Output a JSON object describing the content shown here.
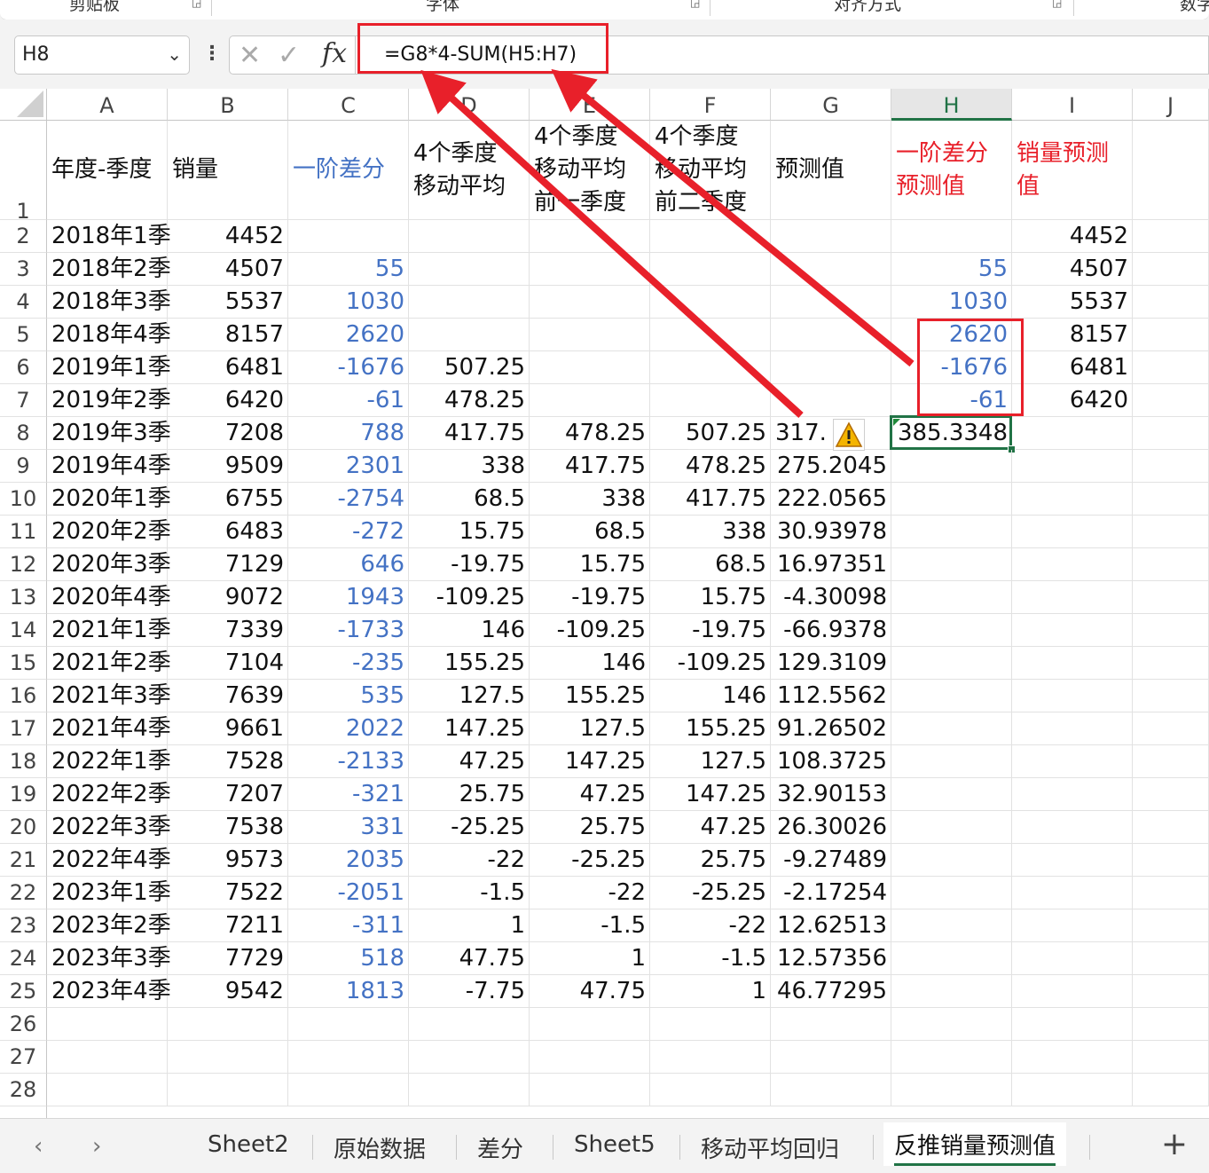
{
  "ribbon": {
    "groups": [
      "剪贴板",
      "字体",
      "对齐方式",
      "数字"
    ]
  },
  "formula_bar": {
    "name_box": "H8",
    "formula": "=G8*4-SUM(H5:H7)"
  },
  "columns": [
    "A",
    "B",
    "C",
    "D",
    "E",
    "F",
    "G",
    "H",
    "I",
    "J"
  ],
  "selected_column": "H",
  "headers": {
    "A": "年度-季度",
    "B": "销量",
    "C": "一阶差分",
    "D_line1": "4个季度",
    "D_line2": "移动平均",
    "E_line1": "4个季度",
    "E_line2": "移动平均",
    "E_line3": "前一季度",
    "F_line1": "4个季度",
    "F_line2": "移动平均",
    "F_line3": "前二季度",
    "G": "预测值",
    "H_line1": "一阶差分",
    "H_line2": "预测值",
    "I_line1": "销量预测",
    "I_line2": "值"
  },
  "rows": [
    {
      "n": "2",
      "A": "2018年1季",
      "B": "4452",
      "C": "",
      "D": "",
      "E": "",
      "F": "",
      "G": "",
      "H": "",
      "I": "4452"
    },
    {
      "n": "3",
      "A": "2018年2季",
      "B": "4507",
      "C": "55",
      "D": "",
      "E": "",
      "F": "",
      "G": "",
      "H": "55",
      "I": "4507"
    },
    {
      "n": "4",
      "A": "2018年3季",
      "B": "5537",
      "C": "1030",
      "D": "",
      "E": "",
      "F": "",
      "G": "",
      "H": "1030",
      "I": "5537"
    },
    {
      "n": "5",
      "A": "2018年4季",
      "B": "8157",
      "C": "2620",
      "D": "",
      "E": "",
      "F": "",
      "G": "",
      "H": "2620",
      "I": "8157"
    },
    {
      "n": "6",
      "A": "2019年1季",
      "B": "6481",
      "C": "-1676",
      "D": "507.25",
      "E": "",
      "F": "",
      "G": "",
      "H": "-1676",
      "I": "6481"
    },
    {
      "n": "7",
      "A": "2019年2季",
      "B": "6420",
      "C": "-61",
      "D": "478.25",
      "E": "",
      "F": "",
      "G": "",
      "H": "-61",
      "I": "6420"
    },
    {
      "n": "8",
      "A": "2019年3季",
      "B": "7208",
      "C": "788",
      "D": "417.75",
      "E": "478.25",
      "F": "507.25",
      "G": "317.",
      "H": "385.3348",
      "I": ""
    },
    {
      "n": "9",
      "A": "2019年4季",
      "B": "9509",
      "C": "2301",
      "D": "338",
      "E": "417.75",
      "F": "478.25",
      "G": "275.2045",
      "H": "",
      "I": ""
    },
    {
      "n": "10",
      "A": "2020年1季",
      "B": "6755",
      "C": "-2754",
      "D": "68.5",
      "E": "338",
      "F": "417.75",
      "G": "222.0565",
      "H": "",
      "I": ""
    },
    {
      "n": "11",
      "A": "2020年2季",
      "B": "6483",
      "C": "-272",
      "D": "15.75",
      "E": "68.5",
      "F": "338",
      "G": "30.93978",
      "H": "",
      "I": ""
    },
    {
      "n": "12",
      "A": "2020年3季",
      "B": "7129",
      "C": "646",
      "D": "-19.75",
      "E": "15.75",
      "F": "68.5",
      "G": "16.97351",
      "H": "",
      "I": ""
    },
    {
      "n": "13",
      "A": "2020年4季",
      "B": "9072",
      "C": "1943",
      "D": "-109.25",
      "E": "-19.75",
      "F": "15.75",
      "G": "-4.30098",
      "H": "",
      "I": ""
    },
    {
      "n": "14",
      "A": "2021年1季",
      "B": "7339",
      "C": "-1733",
      "D": "146",
      "E": "-109.25",
      "F": "-19.75",
      "G": "-66.9378",
      "H": "",
      "I": ""
    },
    {
      "n": "15",
      "A": "2021年2季",
      "B": "7104",
      "C": "-235",
      "D": "155.25",
      "E": "146",
      "F": "-109.25",
      "G": "129.3109",
      "H": "",
      "I": ""
    },
    {
      "n": "16",
      "A": "2021年3季",
      "B": "7639",
      "C": "535",
      "D": "127.5",
      "E": "155.25",
      "F": "146",
      "G": "112.5562",
      "H": "",
      "I": ""
    },
    {
      "n": "17",
      "A": "2021年4季",
      "B": "9661",
      "C": "2022",
      "D": "147.25",
      "E": "127.5",
      "F": "155.25",
      "G": "91.26502",
      "H": "",
      "I": ""
    },
    {
      "n": "18",
      "A": "2022年1季",
      "B": "7528",
      "C": "-2133",
      "D": "47.25",
      "E": "147.25",
      "F": "127.5",
      "G": "108.3725",
      "H": "",
      "I": ""
    },
    {
      "n": "19",
      "A": "2022年2季",
      "B": "7207",
      "C": "-321",
      "D": "25.75",
      "E": "47.25",
      "F": "147.25",
      "G": "32.90153",
      "H": "",
      "I": ""
    },
    {
      "n": "20",
      "A": "2022年3季",
      "B": "7538",
      "C": "331",
      "D": "-25.25",
      "E": "25.75",
      "F": "47.25",
      "G": "26.30026",
      "H": "",
      "I": ""
    },
    {
      "n": "21",
      "A": "2022年4季",
      "B": "9573",
      "C": "2035",
      "D": "-22",
      "E": "-25.25",
      "F": "25.75",
      "G": "-9.27489",
      "H": "",
      "I": ""
    },
    {
      "n": "22",
      "A": "2023年1季",
      "B": "7522",
      "C": "-2051",
      "D": "-1.5",
      "E": "-22",
      "F": "-25.25",
      "G": "-2.17254",
      "H": "",
      "I": ""
    },
    {
      "n": "23",
      "A": "2023年2季",
      "B": "7211",
      "C": "-311",
      "D": "1",
      "E": "-1.5",
      "F": "-22",
      "G": "12.62513",
      "H": "",
      "I": ""
    },
    {
      "n": "24",
      "A": "2023年3季",
      "B": "7729",
      "C": "518",
      "D": "47.75",
      "E": "1",
      "F": "-1.5",
      "G": "12.57356",
      "H": "",
      "I": ""
    },
    {
      "n": "25",
      "A": "2023年4季",
      "B": "9542",
      "C": "1813",
      "D": "-7.75",
      "E": "47.75",
      "F": "1",
      "G": "46.77295",
      "H": "",
      "I": ""
    },
    {
      "n": "26",
      "A": "",
      "B": "",
      "C": "",
      "D": "",
      "E": "",
      "F": "",
      "G": "",
      "H": "",
      "I": ""
    },
    {
      "n": "27",
      "A": "",
      "B": "",
      "C": "",
      "D": "",
      "E": "",
      "F": "",
      "G": "",
      "H": "",
      "I": ""
    },
    {
      "n": "28",
      "A": "",
      "B": "",
      "C": "",
      "D": "",
      "E": "",
      "F": "",
      "G": "",
      "H": "",
      "I": ""
    }
  ],
  "row1_label": "1",
  "sheet_tabs": [
    "Sheet2",
    "原始数据",
    "差分",
    "Sheet5",
    "移动平均回归",
    "反推销量预测值"
  ],
  "active_tab": "反推销量预测值",
  "colors": {
    "accent_green": "#217346",
    "annotation_red": "#e8202a",
    "diff_blue": "#4472c4"
  },
  "icons": [
    "cancel-icon",
    "confirm-icon",
    "fx-icon",
    "chevron-down-icon",
    "more-icon",
    "warning-icon",
    "prev-sheet-icon",
    "next-sheet-icon",
    "add-sheet-icon"
  ]
}
